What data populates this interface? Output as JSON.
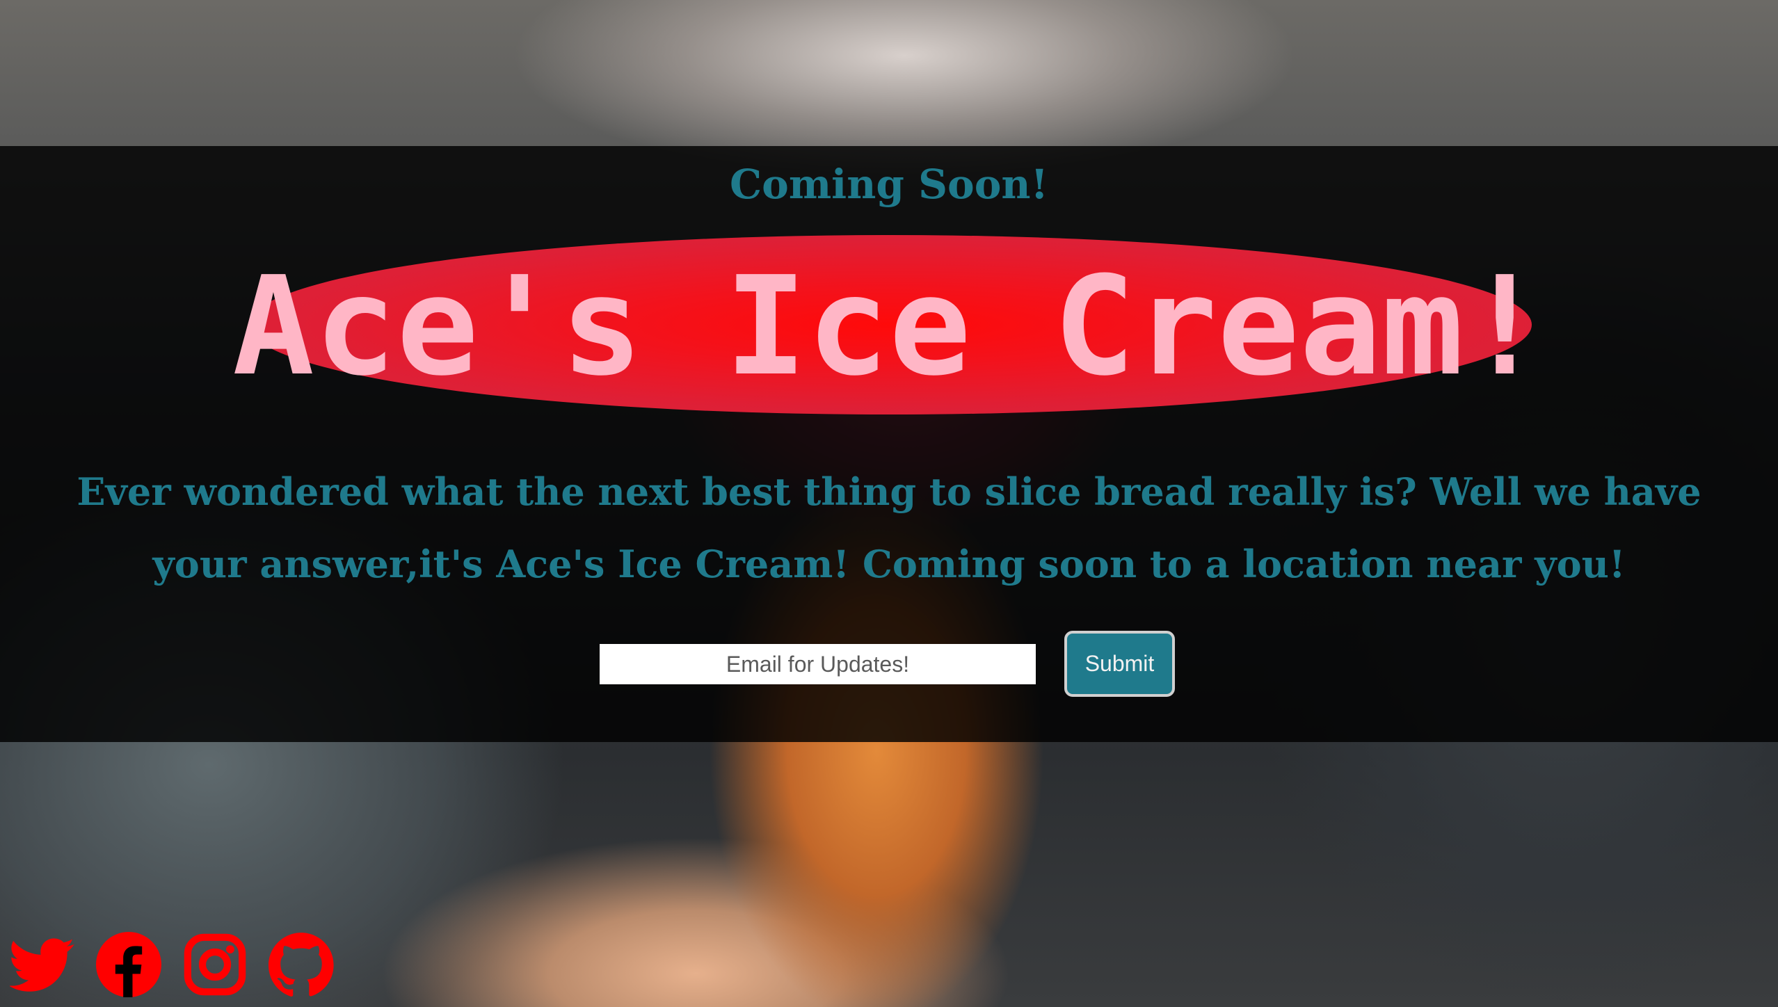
{
  "hero": {
    "eyebrow": "Coming Soon!",
    "title": "Ace's Ice Cream!",
    "tagline": "Ever wondered what the next best thing to slice bread really is? Well we have your answer,it's Ace's Ice Cream! Coming soon to a location near you!"
  },
  "signup": {
    "email_placeholder": "Email for Updates!",
    "submit_label": "Submit"
  },
  "socials": [
    {
      "icon": "twitter-icon"
    },
    {
      "icon": "facebook-icon"
    },
    {
      "icon": "instagram-icon"
    },
    {
      "icon": "github-icon"
    }
  ],
  "colors": {
    "accent_teal": "#1f7a8c",
    "title_pink": "#ffb6c6",
    "badge_red": "#ff0a0a",
    "icon_red": "#ff0000"
  }
}
